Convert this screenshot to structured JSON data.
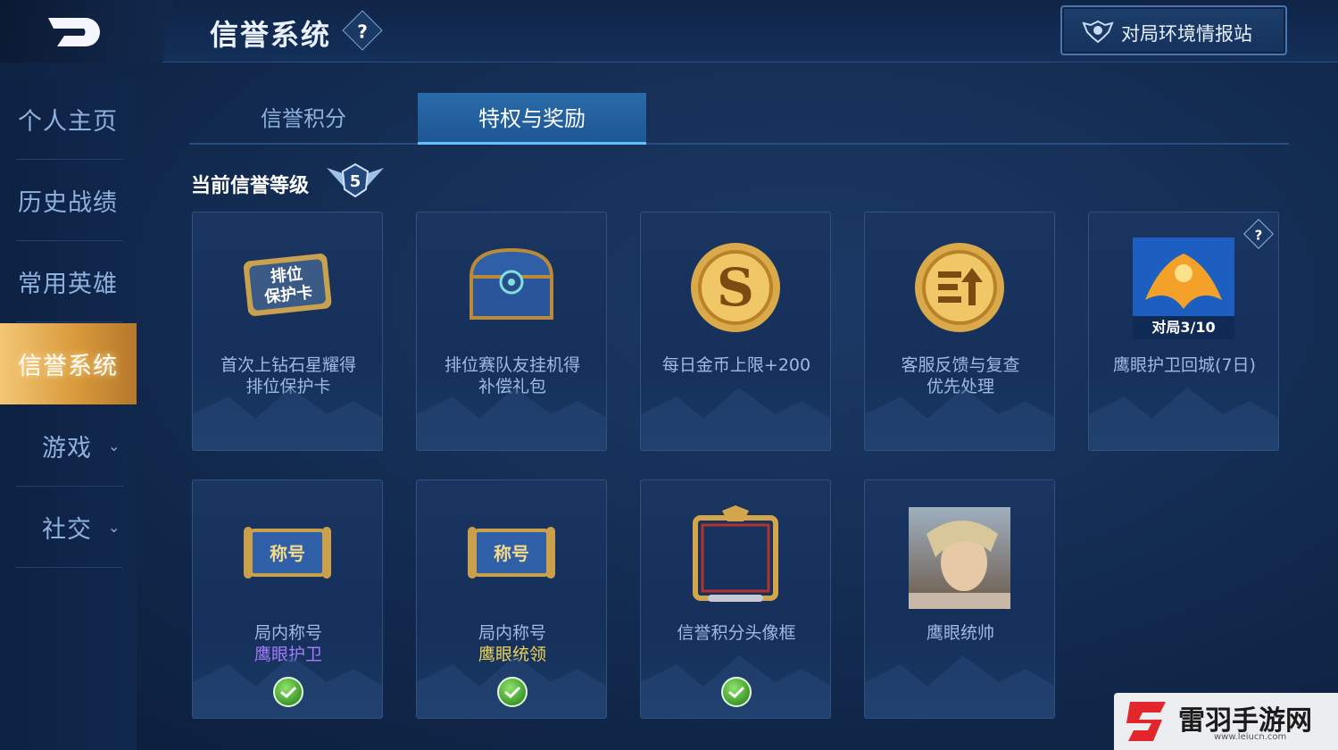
{
  "header": {
    "title": "信誉系统",
    "help_label": "?",
    "intel_button_label": "对局环境情报站"
  },
  "sidebar": {
    "items": [
      {
        "label": "个人主页"
      },
      {
        "label": "历史战绩"
      },
      {
        "label": "常用英雄"
      },
      {
        "label": "信誉系统",
        "active": true
      },
      {
        "label": "游戏",
        "expandable": true
      },
      {
        "label": "社交",
        "expandable": true
      }
    ],
    "chevron": "⌄"
  },
  "tabs": [
    {
      "label": "信誉积分"
    },
    {
      "label": "特权与奖励",
      "active": true
    }
  ],
  "level": {
    "label": "当前信誉等级",
    "value": "5"
  },
  "cards": [
    {
      "name_line1": "首次上钻石星耀得",
      "name_line2": "排位保护卡",
      "art": "rank-protect-card-icon",
      "art_text1": "排位",
      "art_text2": "保护卡"
    },
    {
      "name_line1": "排位赛队友挂机得",
      "name_line2": "补偿礼包",
      "art": "treasure-chest-icon"
    },
    {
      "name_line1": "每日金币上限+200",
      "name_line2": "",
      "art": "gold-coin-icon",
      "art_text1": "S"
    },
    {
      "name_line1": "客服反馈与复查",
      "name_line2": "优先处理",
      "art": "priority-coin-icon"
    },
    {
      "name_line1": "鹰眼护卫回城(7日)",
      "name_line2": "",
      "art": "eagle-recall-icon",
      "art_text1": "对局3/10",
      "help": "?"
    },
    {
      "name_line1": "局内称号",
      "sub": "鹰眼护卫",
      "sub_color": "#a77bff",
      "art": "title-scroll-icon",
      "art_text1": "称号",
      "claimed": true
    },
    {
      "name_line1": "局内称号",
      "sub": "鹰眼统领",
      "sub_color": "#f1d35a",
      "art": "title-scroll-icon",
      "art_text1": "称号",
      "claimed": true
    },
    {
      "name_line1": "信誉积分头像框",
      "name_line2": "",
      "art": "avatar-frame-icon",
      "claimed": true
    },
    {
      "name_line1": "鹰眼统帅",
      "name_line2": "",
      "art": "hero-portrait-icon"
    }
  ],
  "watermark": {
    "text": "雷羽手游网",
    "url": "www.leiucn.com"
  }
}
